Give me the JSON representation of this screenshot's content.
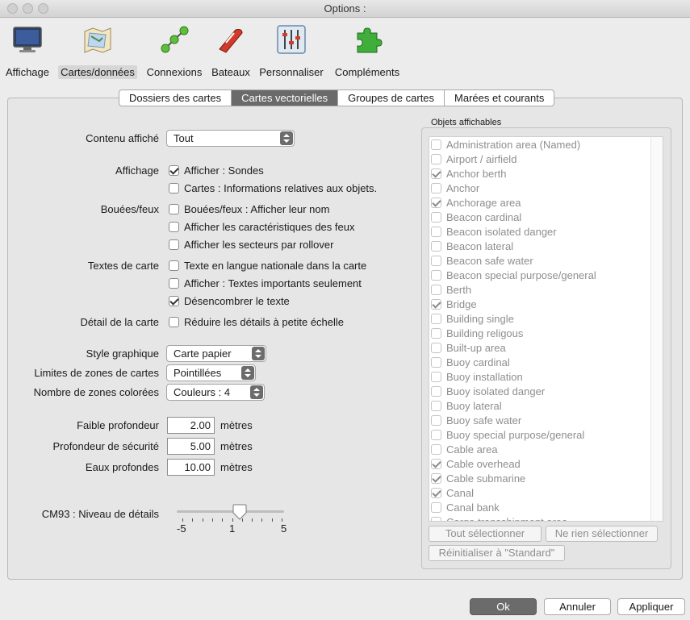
{
  "window": {
    "title": "Options :"
  },
  "toolbar": {
    "items": [
      {
        "label": "Affichage",
        "icon": "monitor-icon"
      },
      {
        "label": "Cartes/données",
        "icon": "charts-icon",
        "selected": true
      },
      {
        "label": "Connexions",
        "icon": "connections-icon"
      },
      {
        "label": "Bateaux",
        "icon": "boat-icon"
      },
      {
        "label": "Personnaliser",
        "icon": "sliders-icon"
      },
      {
        "label": "Compléments",
        "icon": "puzzle-icon"
      }
    ]
  },
  "tabs": [
    {
      "label": "Dossiers des cartes"
    },
    {
      "label": "Cartes vectorielles",
      "active": true
    },
    {
      "label": "Groupes de cartes"
    },
    {
      "label": "Marées et courants"
    }
  ],
  "form": {
    "contenu_label": "Contenu affiché",
    "contenu_value": "Tout",
    "affichage_label": "Affichage",
    "affichage_sondes": {
      "label": "Afficher : Sondes",
      "checked": true
    },
    "affichage_infos": {
      "label": "Cartes : Informations relatives aux objets.",
      "checked": false
    },
    "bouees_label": "Bouées/feux",
    "bouees_nom": {
      "label": "Bouées/feux : Afficher leur nom",
      "checked": false
    },
    "bouees_carac": {
      "label": "Afficher les caractéristiques des feux",
      "checked": false
    },
    "bouees_secteurs": {
      "label": "Afficher les secteurs par rollover",
      "checked": false
    },
    "textes_label": "Textes de carte",
    "textes_langue": {
      "label": "Texte en langue nationale dans la carte",
      "checked": false
    },
    "textes_importants": {
      "label": "Afficher : Textes importants seulement",
      "checked": false
    },
    "textes_desencombrer": {
      "label": "Désencombrer le texte",
      "checked": true
    },
    "detail_label": "Détail de la carte",
    "detail_reduire": {
      "label": "Réduire les détails à petite échelle",
      "checked": false
    },
    "style_label": "Style graphique",
    "style_value": "Carte papier",
    "limites_label": "Limites de zones de cartes",
    "limites_value": "Pointillées",
    "zones_label": "Nombre de zones colorées",
    "zones_value": "Couleurs : 4",
    "faible_label": "Faible profondeur",
    "faible_value": "2.00",
    "securite_label": "Profondeur de sécurité",
    "securite_value": "5.00",
    "eaux_label": "Eaux profondes",
    "eaux_value": "10.00",
    "unit": "mètres",
    "cm93_label": "CM93 : Niveau de détails",
    "cm93_min": "-5",
    "cm93_value": "1",
    "cm93_max": "5"
  },
  "objects": {
    "title": "Objets affichables",
    "items": [
      {
        "label": "Administration area (Named)",
        "checked": false
      },
      {
        "label": "Airport / airfield",
        "checked": false
      },
      {
        "label": "Anchor berth",
        "checked": true
      },
      {
        "label": "Anchor",
        "checked": false
      },
      {
        "label": "Anchorage area",
        "checked": true
      },
      {
        "label": "Beacon cardinal",
        "checked": false
      },
      {
        "label": "Beacon isolated danger",
        "checked": false
      },
      {
        "label": "Beacon lateral",
        "checked": false
      },
      {
        "label": "Beacon safe water",
        "checked": false
      },
      {
        "label": "Beacon special purpose/general",
        "checked": false
      },
      {
        "label": "Berth",
        "checked": false
      },
      {
        "label": "Bridge",
        "checked": true
      },
      {
        "label": "Building single",
        "checked": false
      },
      {
        "label": "Building religous",
        "checked": false
      },
      {
        "label": "Built-up area",
        "checked": false
      },
      {
        "label": "Buoy cardinal",
        "checked": false
      },
      {
        "label": "Buoy installation",
        "checked": false
      },
      {
        "label": "Buoy isolated danger",
        "checked": false
      },
      {
        "label": "Buoy lateral",
        "checked": false
      },
      {
        "label": "Buoy safe water",
        "checked": false
      },
      {
        "label": "Buoy special purpose/general",
        "checked": false
      },
      {
        "label": "Cable area",
        "checked": false
      },
      {
        "label": "Cable overhead",
        "checked": true
      },
      {
        "label": "Cable submarine",
        "checked": true
      },
      {
        "label": "Canal",
        "checked": true
      },
      {
        "label": "Canal bank",
        "checked": false
      },
      {
        "label": "Cargo transshipment area",
        "checked": false
      }
    ],
    "select_all": "Tout sélectionner",
    "select_none": "Ne rien sélectionner",
    "reset": "Réinitialiser à \"Standard\""
  },
  "buttons": {
    "ok": "Ok",
    "cancel": "Annuler",
    "apply": "Appliquer"
  },
  "colors": {
    "tab_active": "#6a6a6a",
    "primary_button": "#6b6b6b"
  }
}
